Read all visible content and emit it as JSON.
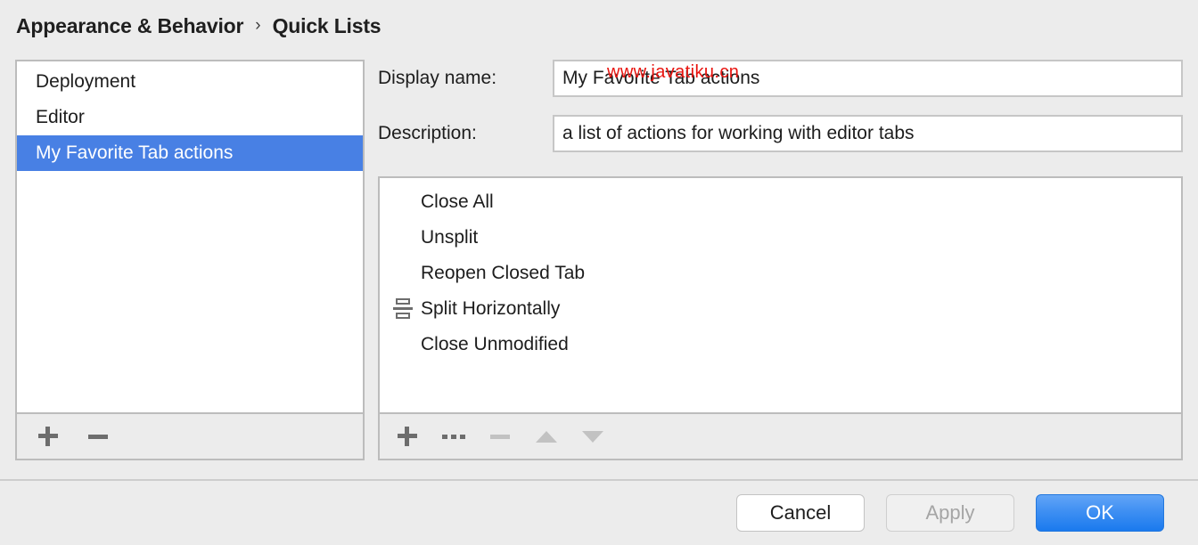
{
  "breadcrumb": {
    "parent": "Appearance & Behavior",
    "separator": "›",
    "current": "Quick Lists"
  },
  "quick_lists_panel": {
    "items": [
      {
        "label": "Deployment",
        "selected": false
      },
      {
        "label": "Editor",
        "selected": false
      },
      {
        "label": "My Favorite Tab actions",
        "selected": true
      }
    ],
    "toolbar": {
      "add": {
        "icon": "plus-icon",
        "label": "+",
        "enabled": true
      },
      "remove": {
        "icon": "minus-icon",
        "label": "−",
        "enabled": true
      }
    }
  },
  "details": {
    "display_name": {
      "label": "Display name:",
      "value": "My Favorite Tab actions",
      "placeholder": ""
    },
    "description": {
      "label": "Description:",
      "value": "a list of actions for working with editor tabs",
      "placeholder": ""
    }
  },
  "actions_panel": {
    "items": [
      {
        "label": "Close All",
        "icon": ""
      },
      {
        "label": "Unsplit",
        "icon": ""
      },
      {
        "label": "Reopen Closed Tab",
        "icon": ""
      },
      {
        "label": "Split Horizontally",
        "icon": "split-horizontally-icon"
      },
      {
        "label": "Close Unmodified",
        "icon": ""
      }
    ],
    "toolbar": {
      "add": {
        "icon": "plus-icon",
        "enabled": true
      },
      "add_separator": {
        "icon": "separator-dashes-icon",
        "enabled": true
      },
      "remove": {
        "icon": "minus-icon",
        "enabled": false
      },
      "move_up": {
        "icon": "triangle-up-icon",
        "enabled": false
      },
      "move_down": {
        "icon": "triangle-down-icon",
        "enabled": false
      }
    }
  },
  "footer": {
    "cancel": "Cancel",
    "apply": "Apply",
    "ok": "OK"
  },
  "watermark": {
    "text": "www.javatiku.cn"
  },
  "colors": {
    "background": "#ececec",
    "selection_blue": "#4880e4",
    "ok_button_blue": "#3d8ef2",
    "panel_border": "#bcbcbc",
    "watermark_red": "#e8140f"
  }
}
